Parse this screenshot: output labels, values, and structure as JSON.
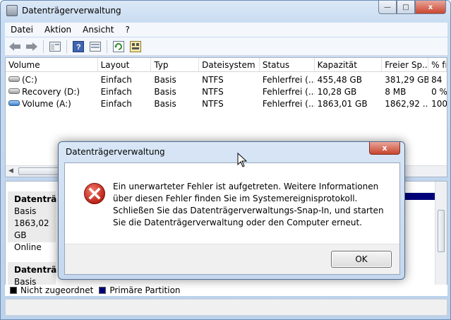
{
  "window": {
    "title": "Datenträgerverwaltung"
  },
  "menu": [
    "Datei",
    "Aktion",
    "Ansicht",
    "?"
  ],
  "toolbar_icons": [
    "back-arrow-icon",
    "forward-arrow-icon",
    "properties-icon",
    "help-icon",
    "view-icon",
    "refresh-icon",
    "settings-icon"
  ],
  "columns": [
    "Volume",
    "Layout",
    "Typ",
    "Dateisystem",
    "Status",
    "Kapazität",
    "Freier Sp...",
    "% fr"
  ],
  "rows": [
    {
      "volume": "(C:)",
      "layout": "Einfach",
      "typ": "Basis",
      "fs": "NTFS",
      "status": "Fehlerfrei (...",
      "kap": "455,48 GB",
      "frei": "381,29 GB",
      "pct": "84"
    },
    {
      "volume": "Recovery  (D:)",
      "layout": "Einfach",
      "typ": "Basis",
      "fs": "NTFS",
      "status": "Fehlerfrei (...",
      "kap": "10,28 GB",
      "frei": "8 MB",
      "pct": "0 %"
    },
    {
      "volume": "Volume  (A:)",
      "layout": "Einfach",
      "typ": "Basis",
      "fs": "NTFS",
      "status": "Fehlerfrei (...",
      "kap": "1863,01 GB",
      "frei": "1862,92 ...",
      "pct": "100"
    }
  ],
  "disks": [
    {
      "name": "Datenträ",
      "type": "Basis",
      "size": "1863,02 GB",
      "state": "Online"
    },
    {
      "name": "Datenträ",
      "type": "Basis"
    }
  ],
  "legend": [
    {
      "label": "Nicht zugeordnet",
      "color": "#000000"
    },
    {
      "label": "Primäre Partition",
      "color": "#00007a"
    }
  ],
  "dialog": {
    "title": "Datenträgerverwaltung",
    "message": "Ein unerwarteter Fehler ist aufgetreten. Weitere Informationen über diesen Fehler finden Sie im Systemereignisprotokoll. Schließen Sie das Datenträgerverwaltungs-Snap-In, und starten Sie die Datenträgerverwaltung oder den Computer erneut.",
    "ok_label": "OK",
    "close_label": "x"
  },
  "caption": {
    "minimize": "—",
    "maximize": "□",
    "close": "x"
  }
}
